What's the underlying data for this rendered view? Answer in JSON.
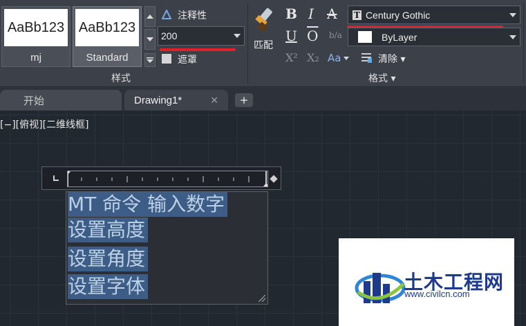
{
  "ribbon": {
    "style_panel": {
      "title": "样式",
      "cards": [
        {
          "preview": "AaBb123",
          "name": "mj"
        },
        {
          "preview": "AaBb123",
          "name": "Standard"
        }
      ],
      "annotative_label": "注释性",
      "height_value": "200",
      "mask_label": "遮罩"
    },
    "format_panel": {
      "title": "格式 ▾",
      "match_label": "匹配",
      "font_value": "Century Gothic",
      "color_value": "ByLayer",
      "clear_label": "清除 ▾",
      "bold": "B",
      "italic": "I",
      "strike": "A",
      "underline": "U",
      "overline": "O",
      "stack": "b/a",
      "superscript": "X²",
      "subscript": "X₂",
      "case": "Aa"
    }
  },
  "tabs": {
    "start": "开始",
    "drawing": "Drawing1*",
    "close": "✕",
    "add": "+"
  },
  "canvas": {
    "viewport_label": "[−][俯视][二维线框]"
  },
  "mtext": {
    "lines": [
      "MT 命令 输入数字",
      "设置高度",
      "设置角度",
      "设置字体"
    ]
  },
  "watermark": {
    "title": "土木工程网",
    "url": "www.civilcn.com"
  },
  "colors": {
    "ribbon_bg": "#3b4049",
    "canvas_bg": "#212830",
    "text_highlight": "#3d5d86",
    "annotation_red": "#e2202a"
  }
}
